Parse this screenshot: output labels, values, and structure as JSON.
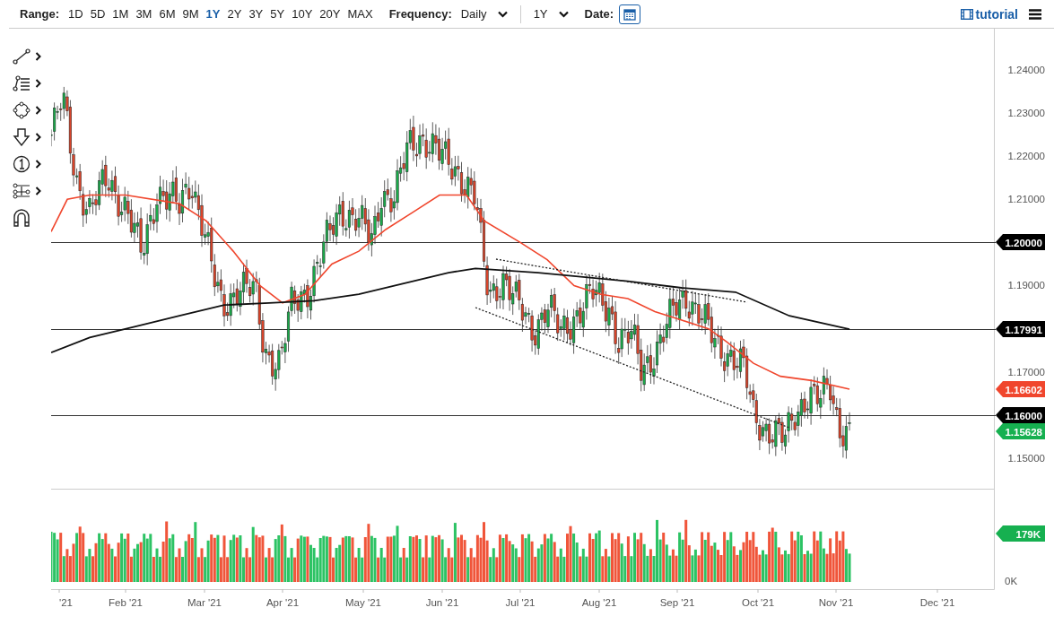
{
  "toolbar": {
    "range_label": "Range:",
    "ranges": [
      {
        "label": "1D",
        "selected": false
      },
      {
        "label": "5D",
        "selected": false
      },
      {
        "label": "1M",
        "selected": false
      },
      {
        "label": "3M",
        "selected": false
      },
      {
        "label": "6M",
        "selected": false
      },
      {
        "label": "9M",
        "selected": false
      },
      {
        "label": "1Y",
        "selected": true
      },
      {
        "label": "2Y",
        "selected": false
      },
      {
        "label": "3Y",
        "selected": false
      },
      {
        "label": "5Y",
        "selected": false
      },
      {
        "label": "10Y",
        "selected": false
      },
      {
        "label": "20Y",
        "selected": false
      },
      {
        "label": "MAX",
        "selected": false
      }
    ],
    "frequency_label": "Frequency:",
    "frequency": "Daily",
    "period": "1Y",
    "date_label": "Date:"
  },
  "tutorial_link": "tutorial",
  "drawing_tools": [
    {
      "kind": "line",
      "has_submenu": true
    },
    {
      "kind": "list",
      "has_submenu": true
    },
    {
      "kind": "shape",
      "has_submenu": true
    },
    {
      "kind": "arrow",
      "has_submenu": true
    },
    {
      "kind": "number",
      "has_submenu": true
    },
    {
      "kind": "measure",
      "has_submenu": true
    },
    {
      "kind": "magnet",
      "has_submenu": false
    }
  ],
  "price_axis": [
    "1.24000",
    "1.23000",
    "1.22000",
    "1.21000",
    "1.19000",
    "1.17000",
    "1.15000"
  ],
  "price_tags": [
    {
      "label": "1.20000",
      "color": "#000000"
    },
    {
      "label": "1.17991",
      "color": "#000000"
    },
    {
      "label": "1.16602",
      "color": "#f0462d"
    },
    {
      "label": "1.16000",
      "color": "#000000"
    },
    {
      "label": "1.15628",
      "color": "#16b050"
    }
  ],
  "volume_tag": {
    "label": "179K",
    "color": "#16b050"
  },
  "volume_axis": [
    "0K"
  ],
  "time_axis": [
    "'21",
    "Feb '21",
    "Mar '21",
    "Apr '21",
    "May '21",
    "Jun '21",
    "Jul '21",
    "Aug '21",
    "Sep '21",
    "Oct '21",
    "Nov '21",
    "Dec '21"
  ]
}
